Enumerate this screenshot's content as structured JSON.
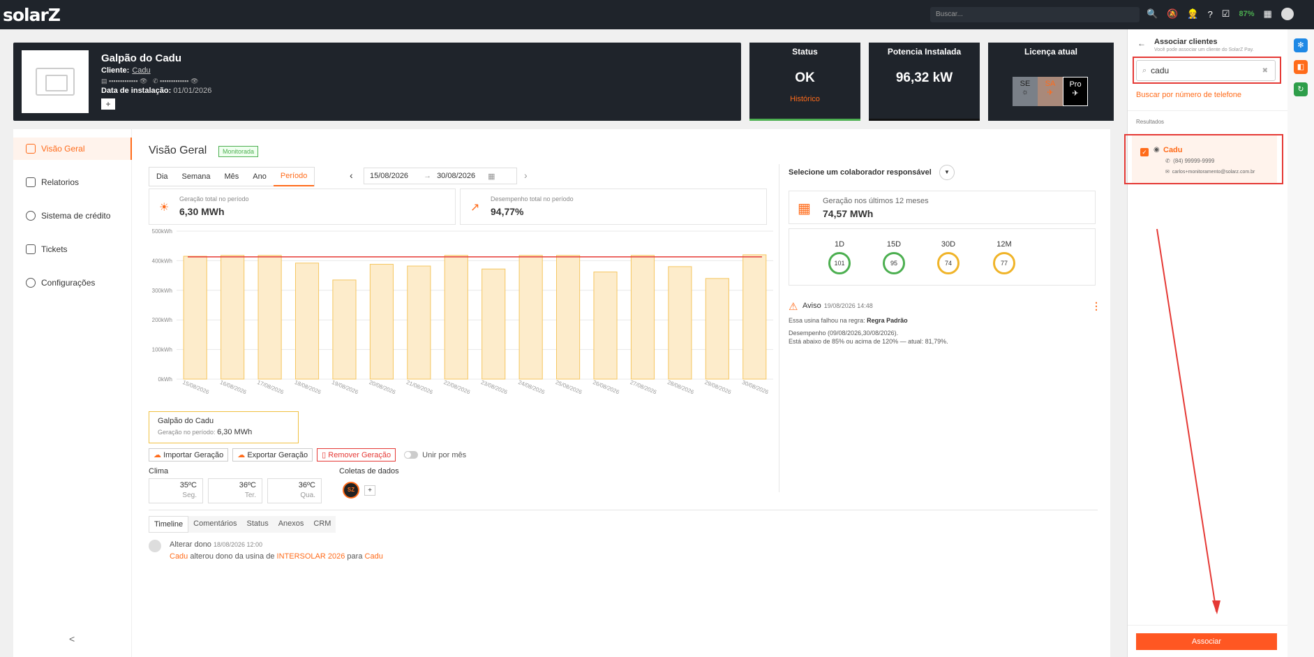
{
  "topbar": {
    "logo": "solarZ",
    "search_placeholder": "Buscar...",
    "battery": "87%"
  },
  "header": {
    "title": "Galpão do Cadu",
    "client_label": "Cliente:",
    "client_name": "Cadu",
    "masked_doc": "▪▪▪▪▪▪▪▪▪▪▪▪▪ 👁",
    "masked_phone": "▪▪▪▪▪▪▪▪▪▪▪▪▪ 👁",
    "install_label": "Data de instalação:",
    "install_date": "01/01/2026",
    "plus": "+"
  },
  "cards": {
    "status": {
      "title": "Status",
      "value": "OK",
      "link": "Histórico"
    },
    "power": {
      "title": "Potencia Instalada",
      "value": "96,32 kW"
    },
    "license": {
      "title": "Licença atual",
      "items": [
        "SE",
        "SA",
        "Pro"
      ]
    }
  },
  "sidebar": {
    "items": [
      {
        "label": "Visão Geral",
        "active": true
      },
      {
        "label": "Relatorios"
      },
      {
        "label": "Sistema de crédito"
      },
      {
        "label": "Tickets"
      },
      {
        "label": "Configurações"
      }
    ],
    "collapse": "<"
  },
  "overview": {
    "title": "Visão Geral",
    "badge": "Monitorada",
    "tabs": [
      "Dia",
      "Semana",
      "Mês",
      "Ano",
      "Período"
    ],
    "active_tab": "Período",
    "date_from": "15/08/2026",
    "date_to": "30/08/2026",
    "kpi_gen_label": "Geração total no período",
    "kpi_gen_value": "6,30 MWh",
    "kpi_perf_label": "Desempenho total no período",
    "kpi_perf_value": "94,77%"
  },
  "chart_data": {
    "type": "bar",
    "categories": [
      "15/08/2026",
      "16/08/2026",
      "17/08/2026",
      "18/08/2026",
      "19/08/2026",
      "20/08/2026",
      "21/08/2026",
      "22/08/2026",
      "23/08/2026",
      "24/08/2026",
      "25/08/2026",
      "26/08/2026",
      "27/08/2026",
      "28/08/2026",
      "29/08/2026",
      "30/08/2026"
    ],
    "values": [
      415,
      418,
      418,
      392,
      335,
      388,
      382,
      418,
      372,
      418,
      418,
      362,
      418,
      380,
      340,
      420
    ],
    "reference_line": 413,
    "yticks": [
      "0kWh",
      "100kWh",
      "200kWh",
      "300kWh",
      "400kWh",
      "500kWh"
    ],
    "ylim": [
      0,
      500
    ],
    "bar_color": "#fdeccb",
    "bar_border": "#f5c660",
    "line_color": "#e53935",
    "grid": true
  },
  "legend": {
    "title": "Galpão do Cadu",
    "sub": "Geração no período:",
    "value": "6,30 MWh"
  },
  "actions": {
    "import": "Importar Geração",
    "export": "Exportar Geração",
    "remove": "Remover Geração",
    "merge": "Unir por mês"
  },
  "weather": {
    "label": "Clima",
    "days": [
      {
        "t": "35ºC",
        "d": "Seg."
      },
      {
        "t": "36ºC",
        "d": "Ter."
      },
      {
        "t": "36ºC",
        "d": "Qua."
      }
    ]
  },
  "collect": {
    "label": "Coletas de dados",
    "badge": "SZ",
    "plus": "+"
  },
  "bottom_tabs": [
    "Timeline",
    "Comentários",
    "Status",
    "Anexos",
    "CRM"
  ],
  "timeline": {
    "title": "Alterar dono",
    "date": "18/08/2026 12:00",
    "actor": "Cadu",
    "text1": "alterou dono da usina de",
    "from": "INTERSOLAR 2026",
    "text2": "para",
    "to": "Cadu"
  },
  "right": {
    "colab": "Selecione um colaborador responsável",
    "gen12_label": "Geração nos últimos 12 meses",
    "gen12_value": "74,57 MWh",
    "rings": [
      {
        "label": "1D",
        "value": "101",
        "color": "#4caf50"
      },
      {
        "label": "15D",
        "value": "95",
        "color": "#4caf50"
      },
      {
        "label": "30D",
        "value": "74",
        "color": "#f0b429"
      },
      {
        "label": "12M",
        "value": "77",
        "color": "#f0b429"
      }
    ],
    "aviso_title": "Aviso",
    "aviso_date": "19/08/2026 14:48",
    "aviso_rule_prefix": "Essa usina falhou na regra:",
    "aviso_rule": "Regra Padrão",
    "aviso_line1": "Desempenho (09/08/2026,30/08/2026).",
    "aviso_line2": "Está abaixo de 85% ou acima de 120% — atual: 81,79%."
  },
  "panel": {
    "title": "Associar clientes",
    "subtitle": "Você pode associar um cliente do SolarZ Pay.",
    "search_value": "cadu",
    "phone_link": "Buscar por número de telefone",
    "results_label": "Resultados",
    "result": {
      "name": "Cadu",
      "phone": "(84) 99999-9999",
      "email": "carlos+monitoramento@solarz.com.br"
    },
    "button": "Associar"
  }
}
